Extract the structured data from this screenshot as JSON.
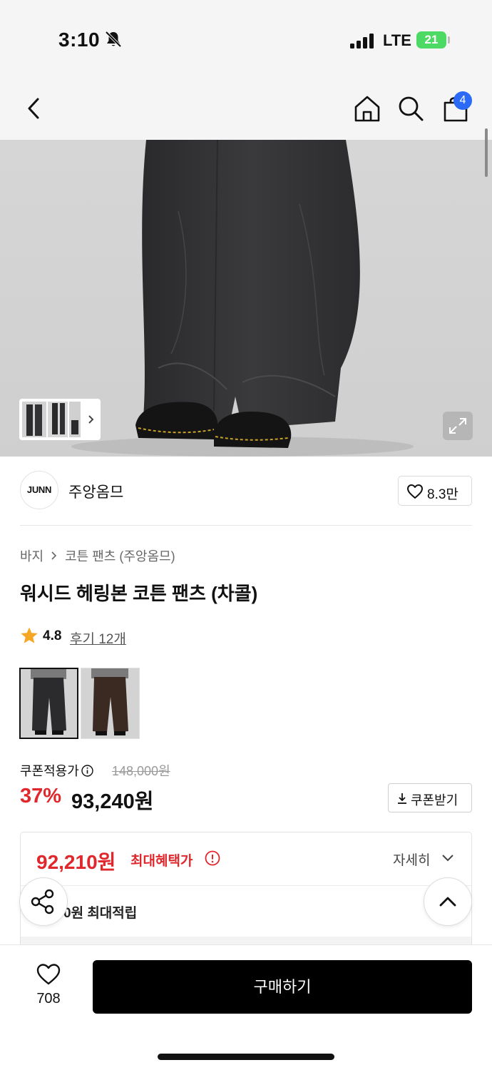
{
  "status_bar": {
    "time": "3:10",
    "network": "LTE",
    "battery": "21"
  },
  "nav": {
    "back_icon": "chevron-left-icon",
    "home_icon": "home-icon",
    "search_icon": "search-icon",
    "cart_icon": "shopping-bag-icon",
    "cart_count": "4"
  },
  "gallery": {
    "expand_icon": "expand-icon",
    "thumbnail_next_icon": "chevron-right-icon"
  },
  "brand": {
    "logo_text": "JUNN",
    "name": "주앙옴므",
    "like_icon": "heart-outline-icon",
    "like_count": "8.3만"
  },
  "breadcrumb": {
    "category": "바지",
    "subcategory": "코튼 팬츠 (주앙옴므)"
  },
  "product": {
    "title": "워시드 헤링본 코튼 팬츠 (차콜)",
    "rating": "4.8",
    "reviews": "후기 12개",
    "swatches": [
      {
        "name": "charcoal",
        "color": "#2b2b2d",
        "selected": true
      },
      {
        "name": "brown",
        "color": "#3b2a22",
        "selected": false
      }
    ]
  },
  "price": {
    "label": "쿠폰적용가",
    "original": "148,000원",
    "discount_rate": "37%",
    "sale": "93,240원",
    "coupon_button": "쿠폰받기"
  },
  "benefit": {
    "max_price": "92,210원",
    "max_label": "최대혜택가",
    "detail_label": "자세히",
    "points": "0원 최대적립"
  },
  "bottom_bar": {
    "wish_count": "708",
    "buy_label": "구매하기"
  },
  "colors": {
    "accent_red": "#e0272c",
    "badge_blue": "#2b6af6",
    "star": "#f5a623"
  }
}
